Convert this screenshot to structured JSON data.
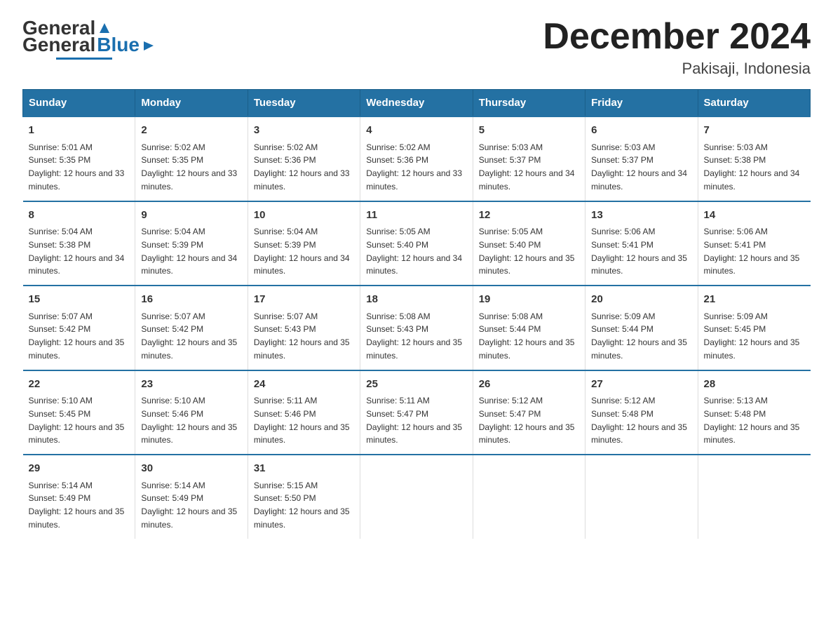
{
  "header": {
    "logo_general": "General",
    "logo_blue": "Blue",
    "month_title": "December 2024",
    "location": "Pakisaji, Indonesia"
  },
  "days_of_week": [
    "Sunday",
    "Monday",
    "Tuesday",
    "Wednesday",
    "Thursday",
    "Friday",
    "Saturday"
  ],
  "weeks": [
    [
      {
        "day": "1",
        "sunrise": "Sunrise: 5:01 AM",
        "sunset": "Sunset: 5:35 PM",
        "daylight": "Daylight: 12 hours and 33 minutes."
      },
      {
        "day": "2",
        "sunrise": "Sunrise: 5:02 AM",
        "sunset": "Sunset: 5:35 PM",
        "daylight": "Daylight: 12 hours and 33 minutes."
      },
      {
        "day": "3",
        "sunrise": "Sunrise: 5:02 AM",
        "sunset": "Sunset: 5:36 PM",
        "daylight": "Daylight: 12 hours and 33 minutes."
      },
      {
        "day": "4",
        "sunrise": "Sunrise: 5:02 AM",
        "sunset": "Sunset: 5:36 PM",
        "daylight": "Daylight: 12 hours and 33 minutes."
      },
      {
        "day": "5",
        "sunrise": "Sunrise: 5:03 AM",
        "sunset": "Sunset: 5:37 PM",
        "daylight": "Daylight: 12 hours and 34 minutes."
      },
      {
        "day": "6",
        "sunrise": "Sunrise: 5:03 AM",
        "sunset": "Sunset: 5:37 PM",
        "daylight": "Daylight: 12 hours and 34 minutes."
      },
      {
        "day": "7",
        "sunrise": "Sunrise: 5:03 AM",
        "sunset": "Sunset: 5:38 PM",
        "daylight": "Daylight: 12 hours and 34 minutes."
      }
    ],
    [
      {
        "day": "8",
        "sunrise": "Sunrise: 5:04 AM",
        "sunset": "Sunset: 5:38 PM",
        "daylight": "Daylight: 12 hours and 34 minutes."
      },
      {
        "day": "9",
        "sunrise": "Sunrise: 5:04 AM",
        "sunset": "Sunset: 5:39 PM",
        "daylight": "Daylight: 12 hours and 34 minutes."
      },
      {
        "day": "10",
        "sunrise": "Sunrise: 5:04 AM",
        "sunset": "Sunset: 5:39 PM",
        "daylight": "Daylight: 12 hours and 34 minutes."
      },
      {
        "day": "11",
        "sunrise": "Sunrise: 5:05 AM",
        "sunset": "Sunset: 5:40 PM",
        "daylight": "Daylight: 12 hours and 34 minutes."
      },
      {
        "day": "12",
        "sunrise": "Sunrise: 5:05 AM",
        "sunset": "Sunset: 5:40 PM",
        "daylight": "Daylight: 12 hours and 35 minutes."
      },
      {
        "day": "13",
        "sunrise": "Sunrise: 5:06 AM",
        "sunset": "Sunset: 5:41 PM",
        "daylight": "Daylight: 12 hours and 35 minutes."
      },
      {
        "day": "14",
        "sunrise": "Sunrise: 5:06 AM",
        "sunset": "Sunset: 5:41 PM",
        "daylight": "Daylight: 12 hours and 35 minutes."
      }
    ],
    [
      {
        "day": "15",
        "sunrise": "Sunrise: 5:07 AM",
        "sunset": "Sunset: 5:42 PM",
        "daylight": "Daylight: 12 hours and 35 minutes."
      },
      {
        "day": "16",
        "sunrise": "Sunrise: 5:07 AM",
        "sunset": "Sunset: 5:42 PM",
        "daylight": "Daylight: 12 hours and 35 minutes."
      },
      {
        "day": "17",
        "sunrise": "Sunrise: 5:07 AM",
        "sunset": "Sunset: 5:43 PM",
        "daylight": "Daylight: 12 hours and 35 minutes."
      },
      {
        "day": "18",
        "sunrise": "Sunrise: 5:08 AM",
        "sunset": "Sunset: 5:43 PM",
        "daylight": "Daylight: 12 hours and 35 minutes."
      },
      {
        "day": "19",
        "sunrise": "Sunrise: 5:08 AM",
        "sunset": "Sunset: 5:44 PM",
        "daylight": "Daylight: 12 hours and 35 minutes."
      },
      {
        "day": "20",
        "sunrise": "Sunrise: 5:09 AM",
        "sunset": "Sunset: 5:44 PM",
        "daylight": "Daylight: 12 hours and 35 minutes."
      },
      {
        "day": "21",
        "sunrise": "Sunrise: 5:09 AM",
        "sunset": "Sunset: 5:45 PM",
        "daylight": "Daylight: 12 hours and 35 minutes."
      }
    ],
    [
      {
        "day": "22",
        "sunrise": "Sunrise: 5:10 AM",
        "sunset": "Sunset: 5:45 PM",
        "daylight": "Daylight: 12 hours and 35 minutes."
      },
      {
        "day": "23",
        "sunrise": "Sunrise: 5:10 AM",
        "sunset": "Sunset: 5:46 PM",
        "daylight": "Daylight: 12 hours and 35 minutes."
      },
      {
        "day": "24",
        "sunrise": "Sunrise: 5:11 AM",
        "sunset": "Sunset: 5:46 PM",
        "daylight": "Daylight: 12 hours and 35 minutes."
      },
      {
        "day": "25",
        "sunrise": "Sunrise: 5:11 AM",
        "sunset": "Sunset: 5:47 PM",
        "daylight": "Daylight: 12 hours and 35 minutes."
      },
      {
        "day": "26",
        "sunrise": "Sunrise: 5:12 AM",
        "sunset": "Sunset: 5:47 PM",
        "daylight": "Daylight: 12 hours and 35 minutes."
      },
      {
        "day": "27",
        "sunrise": "Sunrise: 5:12 AM",
        "sunset": "Sunset: 5:48 PM",
        "daylight": "Daylight: 12 hours and 35 minutes."
      },
      {
        "day": "28",
        "sunrise": "Sunrise: 5:13 AM",
        "sunset": "Sunset: 5:48 PM",
        "daylight": "Daylight: 12 hours and 35 minutes."
      }
    ],
    [
      {
        "day": "29",
        "sunrise": "Sunrise: 5:14 AM",
        "sunset": "Sunset: 5:49 PM",
        "daylight": "Daylight: 12 hours and 35 minutes."
      },
      {
        "day": "30",
        "sunrise": "Sunrise: 5:14 AM",
        "sunset": "Sunset: 5:49 PM",
        "daylight": "Daylight: 12 hours and 35 minutes."
      },
      {
        "day": "31",
        "sunrise": "Sunrise: 5:15 AM",
        "sunset": "Sunset: 5:50 PM",
        "daylight": "Daylight: 12 hours and 35 minutes."
      },
      {
        "day": "",
        "sunrise": "",
        "sunset": "",
        "daylight": ""
      },
      {
        "day": "",
        "sunrise": "",
        "sunset": "",
        "daylight": ""
      },
      {
        "day": "",
        "sunrise": "",
        "sunset": "",
        "daylight": ""
      },
      {
        "day": "",
        "sunrise": "",
        "sunset": "",
        "daylight": ""
      }
    ]
  ]
}
